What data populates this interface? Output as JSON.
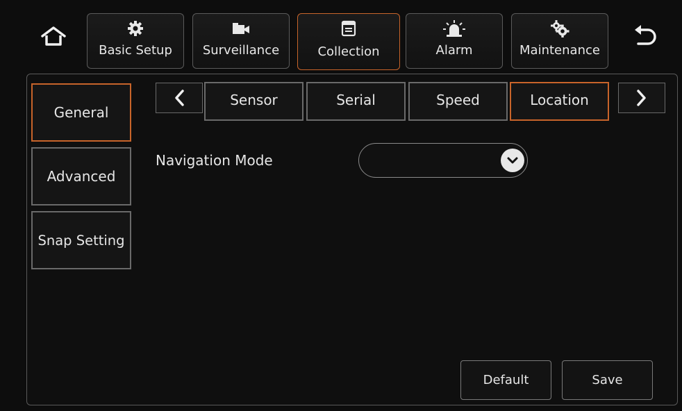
{
  "top_nav": {
    "home_icon": "home-icon",
    "back_icon": "back-icon",
    "tabs": [
      {
        "label": "Basic Setup",
        "icon": "gear-icon"
      },
      {
        "label": "Surveillance",
        "icon": "camera-icon"
      },
      {
        "label": "Collection",
        "icon": "document-icon"
      },
      {
        "label": "Alarm",
        "icon": "alarm-light-icon"
      },
      {
        "label": "Maintenance",
        "icon": "gears-icon"
      }
    ],
    "active_tab": "Collection"
  },
  "sidebar": {
    "items": [
      {
        "label": "General"
      },
      {
        "label": "Advanced"
      },
      {
        "label": "Snap Setting"
      }
    ],
    "active_item": "General"
  },
  "sub_tabs": {
    "items": [
      {
        "label": "Sensor"
      },
      {
        "label": "Serial"
      },
      {
        "label": "Speed"
      },
      {
        "label": "Location"
      }
    ],
    "active_item": "Location",
    "prev_icon": "chevron-left-icon",
    "next_icon": "chevron-right-icon"
  },
  "form": {
    "navigation_mode": {
      "label": "Navigation Mode",
      "value": ""
    }
  },
  "actions": {
    "default_label": "Default",
    "save_label": "Save"
  },
  "colors": {
    "accent": "#c8642a",
    "border": "#6a6a6a",
    "background": "#0d0d0d"
  }
}
